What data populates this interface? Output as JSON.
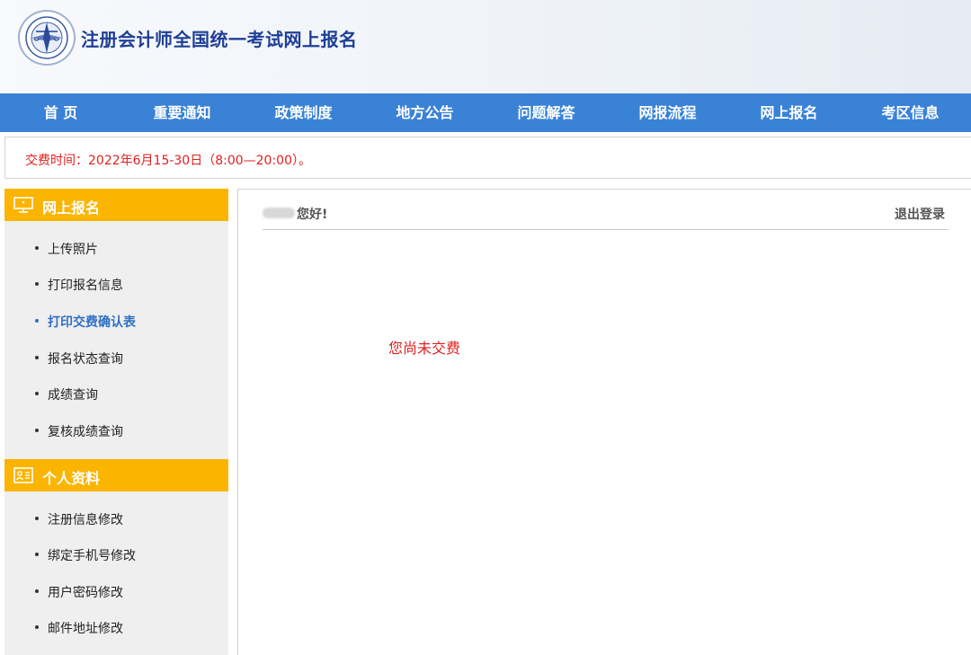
{
  "header": {
    "title": "注册会计师全国统一考试网上报名"
  },
  "nav": {
    "items": [
      "首 页",
      "重要通知",
      "政策制度",
      "地方公告",
      "问题解答",
      "网报流程",
      "网上报名",
      "考区信息"
    ]
  },
  "notice": {
    "text": "交费时间：2022年6月15-30日（8:00—20:00）。"
  },
  "sidebar": {
    "section1": {
      "title": "网上报名",
      "items": [
        "上传照片",
        "打印报名信息",
        "打印交费确认表",
        "报名状态查询",
        "成绩查询",
        "复核成绩查询"
      ],
      "active_index": 2
    },
    "section2": {
      "title": "个人资料",
      "items": [
        "注册信息修改",
        "绑定手机号修改",
        "用户密码修改",
        "邮件地址修改"
      ]
    }
  },
  "main": {
    "greeting": "您好!",
    "logout": "退出登录",
    "status_message": "您尚未交费"
  },
  "colors": {
    "nav_bg": "#3a82d6",
    "sidebar_head": "#fbb500",
    "alert_red": "#e02020",
    "active_link": "#2f6fc3",
    "title_blue": "#1f3f96"
  }
}
